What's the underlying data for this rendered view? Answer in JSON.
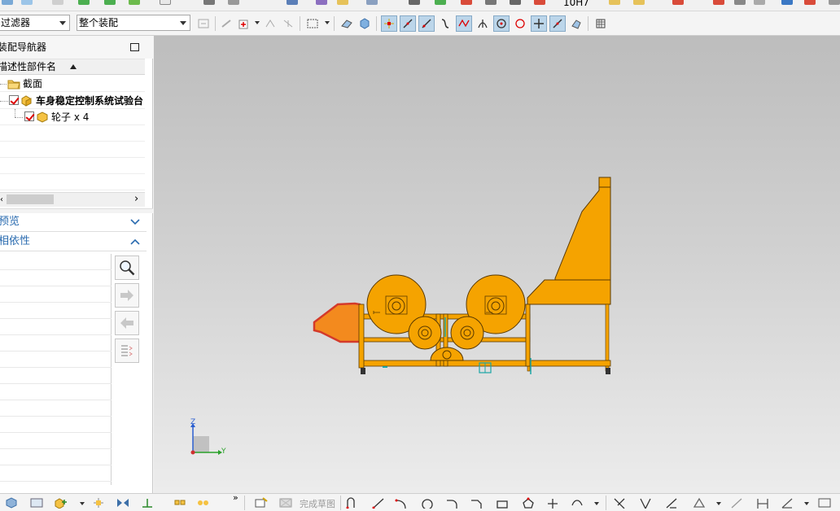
{
  "toolbar": {
    "filter_select": "过滤器",
    "assembly_select": "整个装配",
    "top_label": "10Η7"
  },
  "navigator": {
    "title": "装配导航器",
    "column_header": "描述性部件名",
    "items": [
      {
        "label": "截面",
        "checked": false,
        "icon": "folder-icon"
      },
      {
        "label": "车身稳定控制系统试验台",
        "checked": true,
        "icon": "assembly-icon"
      },
      {
        "label": "轮子 x 4",
        "checked": true,
        "icon": "part-icon"
      }
    ]
  },
  "sections": {
    "preview": "预览",
    "dependency": "相依性"
  },
  "bottombar": {
    "finish_sketch": "完成草图"
  },
  "triad": {
    "z_label": "Z",
    "y_label": "Y"
  },
  "colors": {
    "model_orange": "#f5a300",
    "model_edge": "#5a3a00",
    "selected_face": "#f38a1e",
    "selected_edge": "#d43a2a",
    "accent_blue": "#2b6cb0",
    "hud_teal": "#1aa6a6"
  }
}
